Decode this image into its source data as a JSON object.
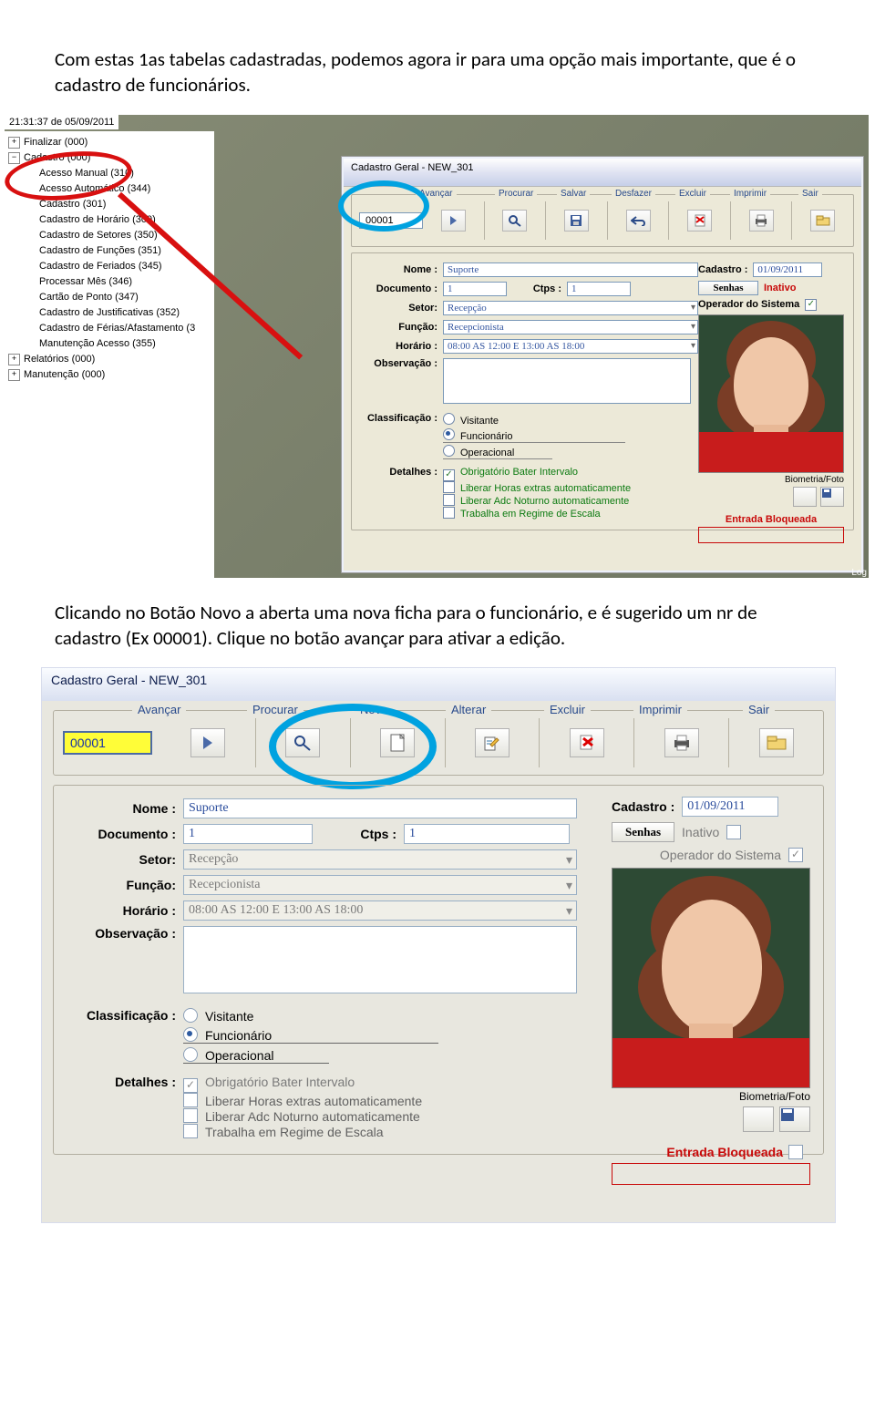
{
  "doc": {
    "para1": "Com estas 1as tabelas cadastradas, podemos agora ir para uma opção mais importante, que é o cadastro de funcionários.",
    "para2": "Clicando no Botão Novo a aberta uma nova ficha para o funcionário, e é sugerido um nr de cadastro (Ex 00001). Clique no botão avançar para ativar a edição."
  },
  "shot1": {
    "timestamp": "21:31:37 de 05/09/2011",
    "tree": {
      "roots": [
        {
          "label": "Finalizar (000)",
          "exp": "+"
        },
        {
          "label": "Cadastro (000)",
          "exp": "−",
          "children": [
            "Acesso Manual (310)",
            "Acesso Automático (344)",
            "Cadastro (301)",
            "Cadastro de Horário (309)",
            "Cadastro de Setores (350)",
            "Cadastro de Funções (351)",
            "Cadastro de Feriados (345)",
            "Processar Mês (346)",
            "Cartão de Ponto (347)",
            "Cadastro de Justificativas (352)",
            "Cadastro de Férias/Afastamento (3",
            "Manutenção Acesso (355)"
          ]
        },
        {
          "label": "Relatórios (000)",
          "exp": "+"
        },
        {
          "label": "Manutenção (000)",
          "exp": "+"
        }
      ]
    },
    "win": {
      "title": "Cadastro Geral - NEW_301",
      "toolbar": {
        "avancar": "Avançar",
        "procurar": "Procurar",
        "salvar": "Salvar",
        "desfazer": "Desfazer",
        "excluir": "Excluir",
        "imprimir": "Imprimir",
        "sair": "Sair"
      },
      "id": "00001",
      "fields": {
        "nome_label": "Nome :",
        "nome": "Suporte",
        "doc_label": "Documento :",
        "doc": "1",
        "ctps_label": "Ctps :",
        "ctps": "1",
        "setor_label": "Setor:",
        "setor": "Recepção",
        "funcao_label": "Função:",
        "funcao": "Recepcionista",
        "horario_label": "Horário :",
        "horario": "08:00 AS 12:00 E 13:00 AS 18:00",
        "obs_label": "Observação :",
        "class_label": "Classificação :",
        "class_opts": [
          "Visitante",
          "Funcionário",
          "Operacional"
        ],
        "det_label": "Detalhes :",
        "det_opts": [
          "Obrigatório Bater Intervalo",
          "Liberar Horas extras automaticamente",
          "Liberar Adc Noturno automaticamente",
          "Trabalha em Regime de Escala"
        ]
      },
      "side": {
        "cadastro_label": "Cadastro :",
        "cadastro": "01/09/2011",
        "senhas": "Senhas",
        "inativo": "Inativo",
        "operador": "Operador do Sistema",
        "biometria": "Biometria/Foto",
        "bloq": "Entrada Bloqueada"
      },
      "log": "Log"
    }
  },
  "shot2": {
    "title": "Cadastro Geral - NEW_301",
    "toolbar": {
      "avancar": "Avançar",
      "procurar": "Procurar",
      "novo": "Novo",
      "alterar": "Alterar",
      "excluir": "Excluir",
      "imprimir": "Imprimir",
      "sair": "Sair"
    },
    "id": "00001",
    "fields": {
      "nome_label": "Nome :",
      "nome": "Suporte",
      "doc_label": "Documento :",
      "doc": "1",
      "ctps_label": "Ctps :",
      "ctps": "1",
      "setor_label": "Setor:",
      "setor": "Recepção",
      "funcao_label": "Função:",
      "funcao": "Recepcionista",
      "horario_label": "Horário :",
      "horario": "08:00 AS 12:00 E 13:00 AS 18:00",
      "obs_label": "Observação :",
      "class_label": "Classificação :",
      "class_opts": [
        "Visitante",
        "Funcionário",
        "Operacional"
      ],
      "det_label": "Detalhes :",
      "det_opts": [
        "Obrigatório Bater Intervalo",
        "Liberar Horas extras automaticamente",
        "Liberar Adc Noturno automaticamente",
        "Trabalha em Regime de Escala"
      ]
    },
    "side": {
      "cadastro_label": "Cadastro :",
      "cadastro": "01/09/2011",
      "senhas": "Senhas",
      "inativo": "Inativo",
      "operador": "Operador do Sistema",
      "biometria": "Biometria/Foto",
      "bloq": "Entrada Bloqueada"
    }
  }
}
